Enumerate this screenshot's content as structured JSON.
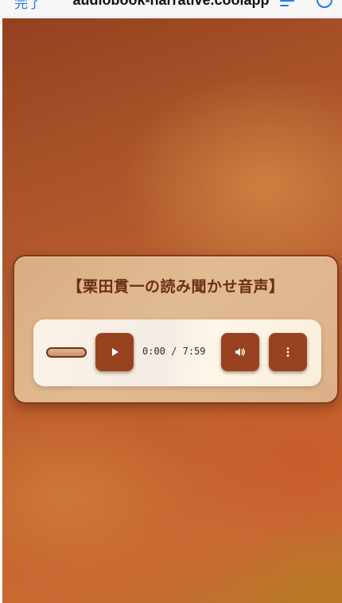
{
  "browser": {
    "done_label": "完了",
    "url": "audiobook-narrative.coolapp"
  },
  "card": {
    "title": "【栗田貫一の読み聞かせ音声】"
  },
  "player": {
    "current_time": "0:00",
    "separator": "/",
    "duration": "7:59",
    "progress": 0,
    "icons": {
      "play": "play-icon",
      "volume": "volume-icon",
      "more": "more-vertical-icon"
    }
  },
  "colors": {
    "button": "#98421f",
    "card": "#dcb088",
    "title": "#6a2e16"
  }
}
